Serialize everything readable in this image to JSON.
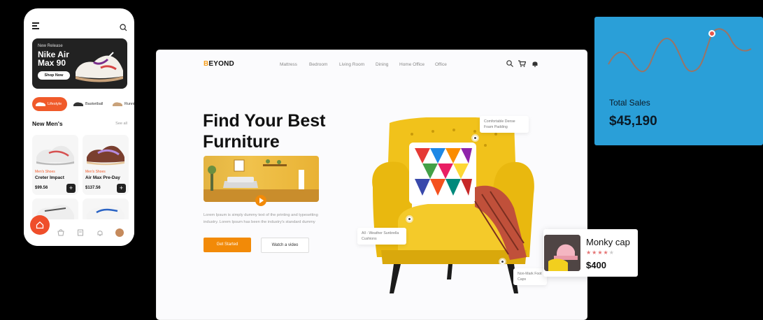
{
  "phone": {
    "hero": {
      "kicker": "New Release",
      "title": "Nike Air Max 90",
      "button": "Shop Now"
    },
    "categories": [
      {
        "label": "Lifestyle",
        "active": true
      },
      {
        "label": "Basketball",
        "active": false
      },
      {
        "label": "Runni",
        "active": false
      }
    ],
    "section_title": "New Men's",
    "see_all": "See all",
    "products": [
      {
        "category": "Men's Shoes",
        "name": "Creter Impact",
        "price": "$99.56",
        "add": "+"
      },
      {
        "category": "Men's Shoes",
        "name": "Air Max Pre-Day",
        "price": "$137.56",
        "add": "+"
      }
    ],
    "tabbar_icons": [
      "home-icon",
      "bag-icon",
      "receipt-icon",
      "bell-icon",
      "avatar"
    ],
    "accent": "#f05a2a"
  },
  "website": {
    "logo_accent": "B",
    "logo_rest": "EYOND",
    "nav": [
      "Mattress",
      "Bedroom",
      "Living Room",
      "Dining",
      "Home Office",
      "Office"
    ],
    "headline": "Find Your Best Furniture",
    "description": "Lorem Ipsum is simply dummy text of the printing and typesetting industry. Lorem Ipsum has been the industry's standard dummy",
    "cta_primary": "Get Started",
    "cta_secondary": "Watch a video",
    "tags": {
      "padding": "Comfortable Dense Foam Padding",
      "cushions": "All - Weather Sunbrella Cushions",
      "feet": "Non-Mark Foot Caps"
    },
    "accent": "#f28a08"
  },
  "sales_card": {
    "label": "Total Sales",
    "value": "$45,190",
    "background": "#2a9fd8"
  },
  "product_card": {
    "name": "Monky cap",
    "rating": 4,
    "rating_max": 5,
    "price": "$400"
  }
}
